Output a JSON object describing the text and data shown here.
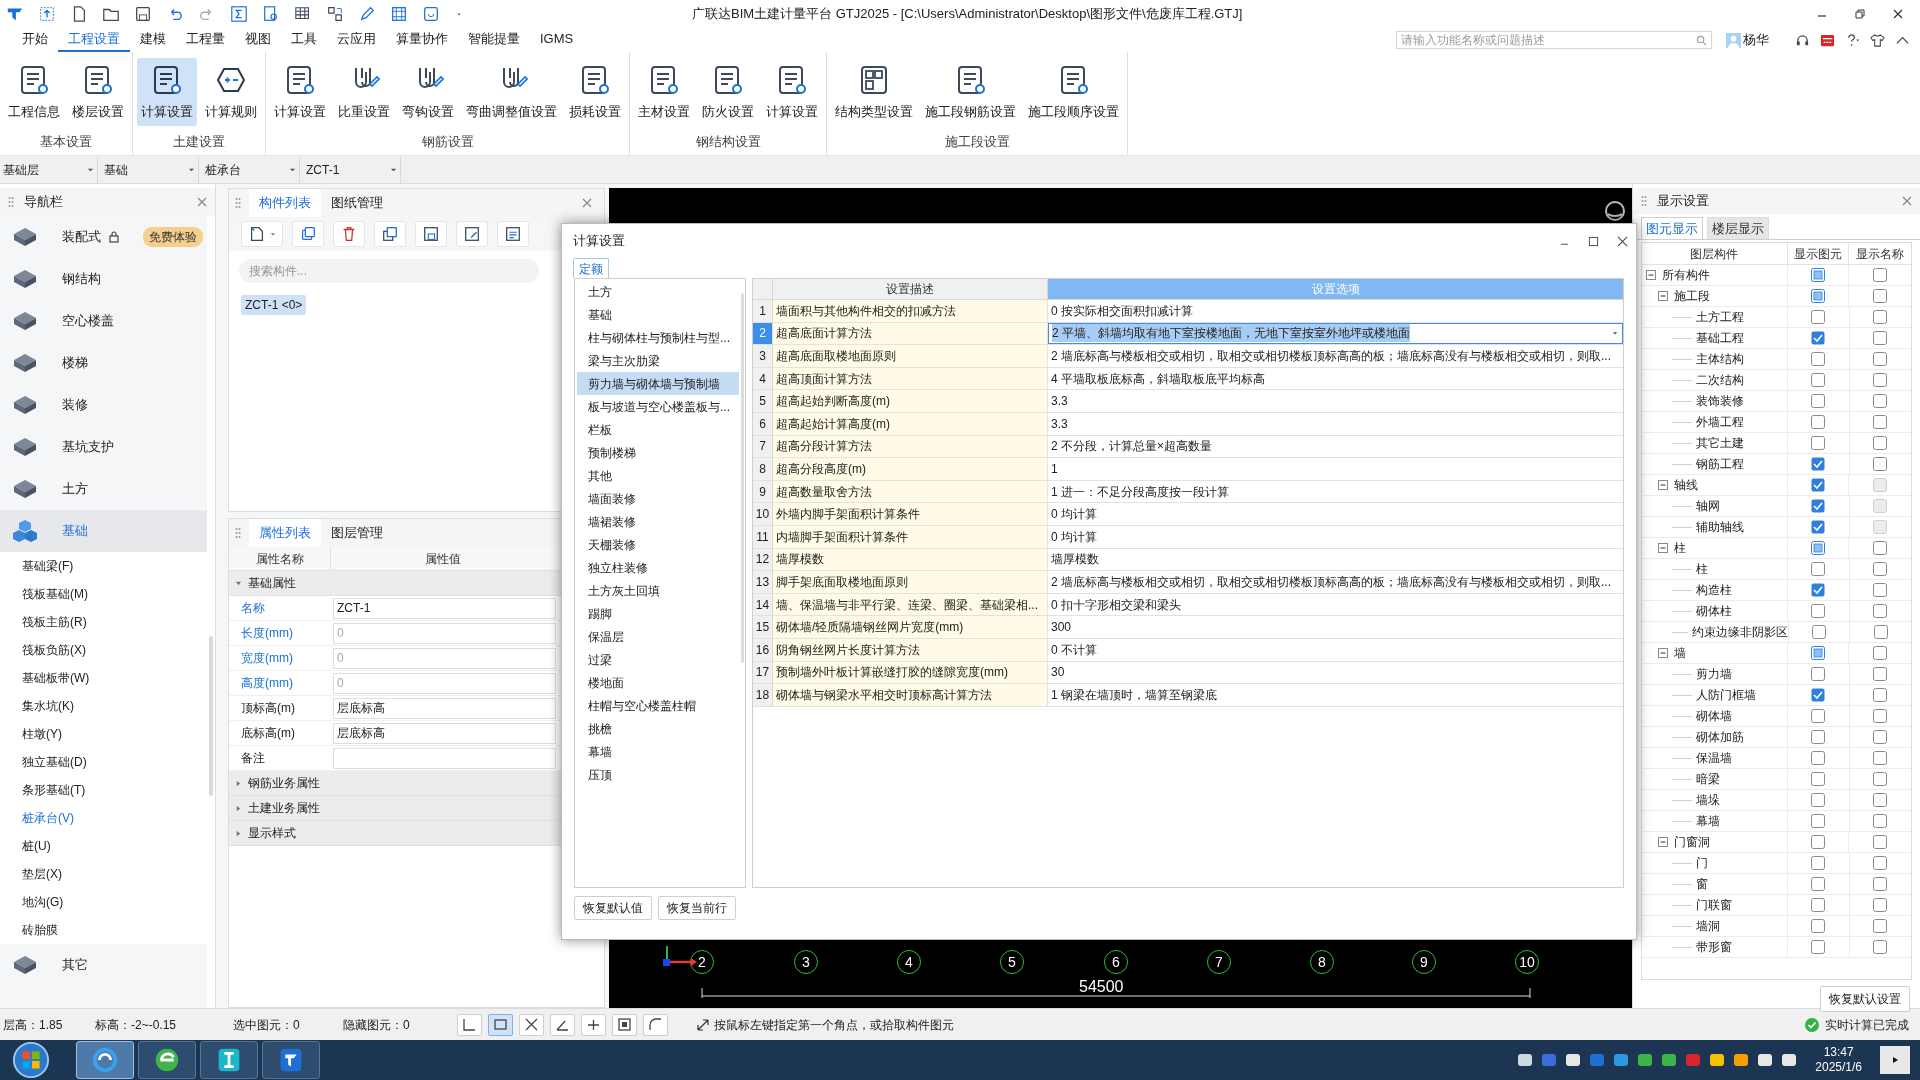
{
  "window": {
    "title": "广联达BIM土建计量平台 GTJ2025 - [C:\\Users\\Administrator\\Desktop\\图形文件\\危废库工程.GTJ]"
  },
  "help_search": {
    "placeholder": "请输入功能名称或问题描述"
  },
  "user": {
    "name": "杨华"
  },
  "menu_tabs": [
    {
      "label": "开始",
      "selected": false
    },
    {
      "label": "工程设置",
      "selected": true
    },
    {
      "label": "建模",
      "selected": false
    },
    {
      "label": "工程量",
      "selected": false
    },
    {
      "label": "视图",
      "selected": false
    },
    {
      "label": "工具",
      "selected": false
    },
    {
      "label": "云应用",
      "selected": false
    },
    {
      "label": "算量协作",
      "selected": false
    },
    {
      "label": "智能提量",
      "selected": false
    },
    {
      "label": "IGMS",
      "selected": false
    }
  ],
  "ribbon_groups": [
    {
      "label": "基本设置",
      "buttons": [
        {
          "label": "工程信息",
          "selected": false
        },
        {
          "label": "楼层设置",
          "selected": false
        }
      ]
    },
    {
      "label": "土建设置",
      "buttons": [
        {
          "label": "计算设置",
          "selected": true
        },
        {
          "label": "计算规则",
          "selected": false
        }
      ]
    },
    {
      "label": "钢筋设置",
      "buttons": [
        {
          "label": "计算设置",
          "selected": false
        },
        {
          "label": "比重设置",
          "selected": false
        },
        {
          "label": "弯钩设置",
          "selected": false
        },
        {
          "label": "弯曲调整值设置",
          "selected": false
        },
        {
          "label": "损耗设置",
          "selected": false
        }
      ]
    },
    {
      "label": "钢结构设置",
      "buttons": [
        {
          "label": "主材设置",
          "selected": false
        },
        {
          "label": "防火设置",
          "selected": false
        },
        {
          "label": "计算设置",
          "selected": false
        }
      ]
    },
    {
      "label": "施工段设置",
      "buttons": [
        {
          "label": "结构类型设置",
          "selected": false
        },
        {
          "label": "施工段钢筋设置",
          "selected": false
        },
        {
          "label": "施工段顺序设置",
          "selected": false
        }
      ]
    }
  ],
  "selectors": [
    {
      "value": "基础层"
    },
    {
      "value": "基础"
    },
    {
      "value": "桩承台"
    },
    {
      "value": "ZCT-1"
    }
  ],
  "navigation": {
    "title": "导航栏",
    "items": [
      {
        "label": "装配式",
        "selected": false,
        "locked": true,
        "badge": "免费体验"
      },
      {
        "label": "钢结构",
        "selected": false
      },
      {
        "label": "空心楼盖",
        "selected": false
      },
      {
        "label": "楼梯",
        "selected": false
      },
      {
        "label": "装修",
        "selected": false
      },
      {
        "label": "基坑支护",
        "selected": false
      },
      {
        "label": "土方",
        "selected": false
      },
      {
        "label": "基础",
        "selected": true,
        "children": [
          {
            "label": "基础梁(F)",
            "selected": false
          },
          {
            "label": "筏板基础(M)",
            "selected": false
          },
          {
            "label": "筏板主筋(R)",
            "selected": false
          },
          {
            "label": "筏板负筋(X)",
            "selected": false
          },
          {
            "label": "基础板带(W)",
            "selected": false
          },
          {
            "label": "集水坑(K)",
            "selected": false
          },
          {
            "label": "柱墩(Y)",
            "selected": false
          },
          {
            "label": "独立基础(D)",
            "selected": false
          },
          {
            "label": "条形基础(T)",
            "selected": false
          },
          {
            "label": "桩承台(V)",
            "selected": true
          },
          {
            "label": "桩(U)",
            "selected": false
          },
          {
            "label": "垫层(X)",
            "selected": false
          },
          {
            "label": "地沟(G)",
            "selected": false
          },
          {
            "label": "砖胎膜",
            "selected": false
          }
        ]
      },
      {
        "label": "其它",
        "selected": false
      }
    ]
  },
  "component_panel": {
    "tabs": [
      {
        "label": "构件列表",
        "selected": true
      },
      {
        "label": "图纸管理",
        "selected": false
      }
    ],
    "search": {
      "placeholder": "搜索构件..."
    },
    "items": [
      {
        "label": "ZCT-1 <0>",
        "selected": true
      }
    ]
  },
  "property_panel": {
    "tabs": [
      {
        "label": "属性列表",
        "selected": true
      },
      {
        "label": "图层管理",
        "selected": false
      }
    ],
    "columns": [
      "属性名称",
      "属性值"
    ],
    "groups": [
      {
        "label": "基础属性",
        "expanded": true,
        "rows": [
          {
            "name": "名称",
            "value": "ZCT-1",
            "public": true,
            "disabled": false
          },
          {
            "name": "长度(mm)",
            "value": "0",
            "public": true,
            "disabled": true
          },
          {
            "name": "宽度(mm)",
            "value": "0",
            "public": true,
            "disabled": true
          },
          {
            "name": "高度(mm)",
            "value": "0",
            "public": true,
            "disabled": true
          },
          {
            "name": "顶标高(m)",
            "value": "层底标高",
            "public": false,
            "disabled": false
          },
          {
            "name": "底标高(m)",
            "value": "层底标高",
            "public": false,
            "disabled": false
          },
          {
            "name": "备注",
            "public": false,
            "disabled": false
          }
        ]
      },
      {
        "label": "钢筋业务属性",
        "expanded": false
      },
      {
        "label": "土建业务属性",
        "expanded": false
      },
      {
        "label": "显示样式",
        "expanded": false
      }
    ]
  },
  "canvas": {
    "axis_labels": [
      "2",
      "3",
      "4",
      "5",
      "6",
      "7",
      "8",
      "9",
      "10"
    ],
    "dimension": "54500"
  },
  "dialog": {
    "title": "计算设置",
    "tabs": [
      {
        "label": "定额",
        "selected": true
      }
    ],
    "categories": [
      {
        "label": "土方",
        "selected": false
      },
      {
        "label": "基础",
        "selected": false
      },
      {
        "label": "柱与砌体柱与预制柱与型...",
        "selected": false
      },
      {
        "label": "梁与主次肋梁",
        "selected": false
      },
      {
        "label": "剪力墙与砌体墙与预制墙",
        "selected": true
      },
      {
        "label": "板与坡道与空心楼盖板与...",
        "selected": false
      },
      {
        "label": "栏板",
        "selected": false
      },
      {
        "label": "预制楼梯",
        "selected": false
      },
      {
        "label": "其他",
        "selected": false
      },
      {
        "label": "墙面装修",
        "selected": false
      },
      {
        "label": "墙裙装修",
        "selected": false
      },
      {
        "label": "天棚装修",
        "selected": false
      },
      {
        "label": "独立柱装修",
        "selected": false
      },
      {
        "label": "土方灰土回填",
        "selected": false
      },
      {
        "label": "踢脚",
        "selected": false
      },
      {
        "label": "保温层",
        "selected": false
      },
      {
        "label": "过梁",
        "selected": false
      },
      {
        "label": "楼地面",
        "selected": false
      },
      {
        "label": "柱帽与空心楼盖柱帽",
        "selected": false
      },
      {
        "label": "挑檐",
        "selected": false
      },
      {
        "label": "幕墙",
        "selected": false
      },
      {
        "label": "压顶",
        "selected": false
      }
    ],
    "table": {
      "columns": [
        "设置描述",
        "设置选项"
      ],
      "rows": [
        {
          "number": "1",
          "description": "墙面积与其他构件相交的扣减方法",
          "value": "0 按实际相交面积扣减计算",
          "selected": false
        },
        {
          "number": "2",
          "description": "超高底面计算方法",
          "value": "2 平墙、斜墙均取有地下室按楼地面，无地下室按室外地坪或楼地面",
          "selected": true
        },
        {
          "number": "3",
          "description": "超高底面取楼地面原则",
          "value": "2 墙底标高与楼板相交或相切，取相交或相切楼板顶标高高的板；墙底标高没有与楼板相交或相切，则取...",
          "selected": false
        },
        {
          "number": "4",
          "description": "超高顶面计算方法",
          "value": "4 平墙取板底标高，斜墙取板底平均标高",
          "selected": false
        },
        {
          "number": "5",
          "description": "超高起始判断高度(m)",
          "value": "3.3",
          "selected": false
        },
        {
          "number": "6",
          "description": "超高起始计算高度(m)",
          "value": "3.3",
          "selected": false
        },
        {
          "number": "7",
          "description": "超高分段计算方法",
          "value": "2 不分段，计算总量×超高数量",
          "selected": false
        },
        {
          "number": "8",
          "description": "超高分段高度(m)",
          "value": "1",
          "selected": false
        },
        {
          "number": "9",
          "description": "超高数量取舍方法",
          "value": "1 进一：不足分段高度按一段计算",
          "selected": false
        },
        {
          "number": "10",
          "description": "外墙内脚手架面积计算条件",
          "value": "0 均计算",
          "selected": false
        },
        {
          "number": "11",
          "description": "内墙脚手架面积计算条件",
          "value": "0 均计算",
          "selected": false
        },
        {
          "number": "12",
          "description": "墙厚模数",
          "value": "墙厚模数",
          "selected": false
        },
        {
          "number": "13",
          "description": "脚手架底面取楼地面原则",
          "value": "2 墙底标高与楼板相交或相切，取相交或相切楼板顶标高高的板；墙底标高没有与楼板相交或相切，则取...",
          "selected": false
        },
        {
          "number": "14",
          "description": "墙、保温墙与非平行梁、连梁、圈梁、基础梁相...",
          "value": "0 扣十字形相交梁和梁头",
          "selected": false
        },
        {
          "number": "15",
          "description": "砌体墙/轻质隔墙钢丝网片宽度(mm)",
          "value": "300",
          "selected": false
        },
        {
          "number": "16",
          "description": "阴角钢丝网片长度计算方法",
          "value": "0 不计算",
          "selected": false
        },
        {
          "number": "17",
          "description": "预制墙外叶板计算嵌缝打胶的缝隙宽度(mm)",
          "value": "30",
          "selected": false
        },
        {
          "number": "18",
          "description": "砌体墙与钢梁水平相交时顶标高计算方法",
          "value": "1 钢梁在墙顶时，墙算至钢梁底",
          "selected": false
        }
      ]
    },
    "buttons": [
      "恢复默认值",
      "恢复当前行"
    ]
  },
  "display_panel": {
    "title": "显示设置",
    "tabs": [
      {
        "label": "图元显示",
        "selected": true
      },
      {
        "label": "楼层显示",
        "selected": false
      }
    ],
    "columns": [
      "图层构件",
      "显示图元",
      "显示名称"
    ],
    "tree": [
      {
        "label": "所有构件",
        "element_checked": false,
        "element_partial": true,
        "name_checked": false,
        "name_disabled": false,
        "expanded": true,
        "children": [
          {
            "label": "施工段",
            "element_checked": false,
            "element_partial": true,
            "name_checked": false,
            "name_disabled": false,
            "expanded": true,
            "children": [
              {
                "label": "土方工程",
                "element_checked": false,
                "element_partial": false,
                "name_checked": false,
                "name_disabled": false
              },
              {
                "label": "基础工程",
                "element_checked": true,
                "element_partial": false,
                "name_checked": false,
                "name_disabled": false
              },
              {
                "label": "主体结构",
                "element_checked": false,
                "element_partial": false,
                "name_checked": false,
                "name_disabled": false
              },
              {
                "label": "二次结构",
                "element_checked": false,
                "element_partial": false,
                "name_checked": false,
                "name_disabled": false
              },
              {
                "label": "装饰装修",
                "element_checked": false,
                "element_partial": false,
                "name_checked": false,
                "name_disabled": false
              },
              {
                "label": "外墙工程",
                "element_checked": false,
                "element_partial": false,
                "name_checked": false,
                "name_disabled": false
              },
              {
                "label": "其它土建",
                "element_checked": false,
                "element_partial": false,
                "name_checked": false,
                "name_disabled": false
              },
              {
                "label": "钢筋工程",
                "element_checked": true,
                "element_partial": false,
                "name_checked": false,
                "name_disabled": false
              }
            ]
          },
          {
            "label": "轴线",
            "element_checked": true,
            "element_partial": false,
            "name_checked": false,
            "name_disabled": true,
            "expanded": true,
            "children": [
              {
                "label": "轴网",
                "element_checked": true,
                "element_partial": false,
                "name_checked": false,
                "name_disabled": true
              },
              {
                "label": "辅助轴线",
                "element_checked": true,
                "element_partial": false,
                "name_checked": false,
                "name_disabled": true
              }
            ]
          },
          {
            "label": "柱",
            "element_checked": false,
            "element_partial": true,
            "name_checked": false,
            "name_disabled": false,
            "expanded": true,
            "children": [
              {
                "label": "柱",
                "element_checked": false,
                "element_partial": false,
                "name_checked": false,
                "name_disabled": false
              },
              {
                "label": "构造柱",
                "element_checked": true,
                "element_partial": false,
                "name_checked": false,
                "name_disabled": false
              },
              {
                "label": "砌体柱",
                "element_checked": false,
                "element_partial": false,
                "name_checked": false,
                "name_disabled": false
              },
              {
                "label": "约束边缘非阴影区",
                "element_checked": false,
                "element_partial": false,
                "name_checked": false,
                "name_disabled": false
              }
            ]
          },
          {
            "label": "墙",
            "element_checked": false,
            "element_partial": true,
            "name_checked": false,
            "name_disabled": false,
            "expanded": true,
            "children": [
              {
                "label": "剪力墙",
                "element_checked": false,
                "element_partial": false,
                "name_checked": false,
                "name_disabled": false
              },
              {
                "label": "人防门框墙",
                "element_checked": true,
                "element_partial": false,
                "name_checked": false,
                "name_disabled": false
              },
              {
                "label": "砌体墙",
                "element_checked": false,
                "element_partial": false,
                "name_checked": false,
                "name_disabled": false
              },
              {
                "label": "砌体加筋",
                "element_checked": false,
                "element_partial": false,
                "name_checked": false,
                "name_disabled": false
              },
              {
                "label": "保温墙",
                "element_checked": false,
                "element_partial": false,
                "name_checked": false,
                "name_disabled": false
              },
              {
                "label": "暗梁",
                "element_checked": false,
                "element_partial": false,
                "name_checked": false,
                "name_disabled": false
              },
              {
                "label": "墙垛",
                "element_checked": false,
                "element_partial": false,
                "name_checked": false,
                "name_disabled": false
              },
              {
                "label": "幕墙",
                "element_checked": false,
                "element_partial": false,
                "name_checked": false,
                "name_disabled": false
              }
            ]
          },
          {
            "label": "门窗洞",
            "element_checked": false,
            "element_partial": false,
            "name_checked": false,
            "name_disabled": false,
            "expanded": true,
            "children": [
              {
                "label": "门",
                "element_checked": false,
                "element_partial": false,
                "name_checked": false,
                "name_disabled": false
              },
              {
                "label": "窗",
                "element_checked": false,
                "element_partial": false,
                "name_checked": false,
                "name_disabled": false
              },
              {
                "label": "门联窗",
                "element_checked": false,
                "element_partial": false,
                "name_checked": false,
                "name_disabled": false
              },
              {
                "label": "墙洞",
                "element_checked": false,
                "element_partial": false,
                "name_checked": false,
                "name_disabled": false
              },
              {
                "label": "带形窗",
                "element_checked": false,
                "element_partial": false,
                "name_checked": false,
                "name_disabled": false
              }
            ]
          }
        ]
      }
    ],
    "button": "恢复默认设置"
  },
  "status_bar": {
    "fields": [
      "层高：1.85",
      "标高：-2~-0.15",
      "选中图元：0",
      "隐藏图元：0"
    ],
    "tools": [
      {
        "selected": false
      },
      {
        "selected": true
      },
      {
        "selected": false
      },
      {
        "selected": false
      },
      {
        "selected": false
      },
      {
        "selected": false
      },
      {
        "selected": false
      }
    ],
    "hint": "按鼠标左键指定第一个角点，或拾取构件图元",
    "status": "实时计算已完成"
  },
  "taskbar": {
    "apps": [
      {
        "active": true
      },
      {
        "active": false
      },
      {
        "active": false
      },
      {
        "active": false
      }
    ],
    "time": "13:47",
    "date": "2025/1/6"
  }
}
